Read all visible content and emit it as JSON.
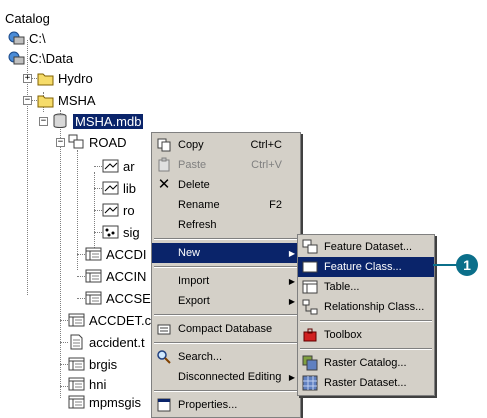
{
  "tree": {
    "root": "Catalog",
    "items": [
      {
        "label": "C:\\",
        "icon": "drive-icon"
      },
      {
        "label": "C:\\Data",
        "icon": "drive-icon"
      },
      {
        "label": "Hydro",
        "icon": "folder-icon"
      },
      {
        "label": "MSHA",
        "icon": "folder-icon"
      },
      {
        "label": "MSHA.mdb",
        "icon": "database-icon"
      },
      {
        "label": "ROAD",
        "icon": "feature-dataset-icon"
      },
      {
        "label": "ar",
        "icon": "line-feature-class-icon"
      },
      {
        "label": "lib",
        "icon": "line-feature-class-icon"
      },
      {
        "label": "ro",
        "icon": "line-feature-class-icon"
      },
      {
        "label": "sig",
        "icon": "point-feature-class-icon"
      },
      {
        "label": "ACCDI",
        "icon": "table-icon"
      },
      {
        "label": "ACCIN",
        "icon": "table-icon"
      },
      {
        "label": "ACCSE",
        "icon": "table-icon"
      },
      {
        "label": "ACCDET.c",
        "icon": "table-icon"
      },
      {
        "label": "accident.t",
        "icon": "text-file-icon"
      },
      {
        "label": "brgis",
        "icon": "table-icon"
      },
      {
        "label": "hni",
        "icon": "table-icon"
      },
      {
        "label": "mpmsgis",
        "icon": "table-icon"
      }
    ]
  },
  "context_menu": {
    "items": [
      {
        "label": "Copy",
        "shortcut": "Ctrl+C",
        "icon": "copy-icon"
      },
      {
        "label": "Paste",
        "shortcut": "Ctrl+V",
        "icon": "paste-icon",
        "disabled": true
      },
      {
        "label": "Delete",
        "icon": "delete-icon"
      },
      {
        "label": "Rename",
        "shortcut": "F2"
      },
      {
        "label": "Refresh"
      },
      {
        "label": "New",
        "submenu": true,
        "highlighted": true
      },
      {
        "label": "Import",
        "submenu": true
      },
      {
        "label": "Export",
        "submenu": true
      },
      {
        "label": "Compact Database",
        "icon": "compact-database-icon"
      },
      {
        "label": "Search...",
        "icon": "search-icon"
      },
      {
        "label": "Disconnected Editing",
        "submenu": true
      },
      {
        "label": "Properties...",
        "icon": "properties-icon"
      }
    ]
  },
  "submenu": {
    "items": [
      {
        "label": "Feature Dataset...",
        "icon": "feature-dataset-icon"
      },
      {
        "label": "Feature Class...",
        "icon": "feature-class-icon",
        "highlighted": true
      },
      {
        "label": "Table...",
        "icon": "table-icon"
      },
      {
        "label": "Relationship Class...",
        "icon": "relationship-class-icon"
      },
      {
        "label": "Toolbox",
        "icon": "toolbox-icon"
      },
      {
        "label": "Raster Catalog...",
        "icon": "raster-catalog-icon"
      },
      {
        "label": "Raster Dataset...",
        "icon": "raster-dataset-icon"
      }
    ]
  },
  "callout": {
    "label": "1"
  },
  "colors": {
    "highlight": "#0a246a",
    "menu_bg": "#d4d0c8",
    "callout": "#0b6f8a"
  }
}
